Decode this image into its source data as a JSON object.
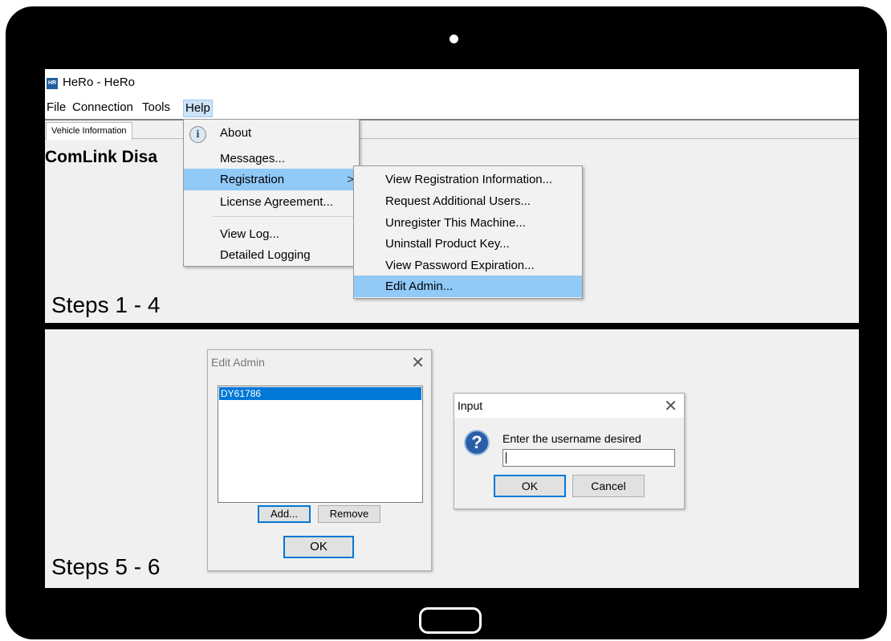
{
  "top": {
    "app_title": "HeRo - HeRo",
    "app_icon_text": "HR",
    "menu": [
      "File",
      "Connection",
      "Tools",
      "Help"
    ],
    "tab": "Vehicle Information",
    "page_heading": "ComLink Disa",
    "steps_label": "Steps 1 - 4",
    "help_menu": [
      "About",
      "Messages...",
      "Registration",
      "License Agreement...",
      "View Log...",
      "Detailed Logging"
    ],
    "registration_submenu": [
      "View Registration Information...",
      "Request Additional Users...",
      "Unregister This Machine...",
      "Uninstall Product Key...",
      "View Password Expiration...",
      "Edit Admin..."
    ],
    "submenu_chevron": ">"
  },
  "bottom": {
    "steps_label": "Steps 5 - 6",
    "edit_admin": {
      "title": "Edit Admin",
      "close": "✕",
      "list_items": [
        "DY61786"
      ],
      "add_button": "Add...",
      "remove_button": "Remove",
      "ok_button": "OK"
    },
    "input_dialog": {
      "title": "Input",
      "close": "✕",
      "prompt": "Enter the username desired",
      "value": "",
      "ok_button": "OK",
      "cancel_button": "Cancel"
    }
  },
  "colors": {
    "bezel": "#000000",
    "highlight": "#91c9f7",
    "selection": "#0078d7"
  }
}
